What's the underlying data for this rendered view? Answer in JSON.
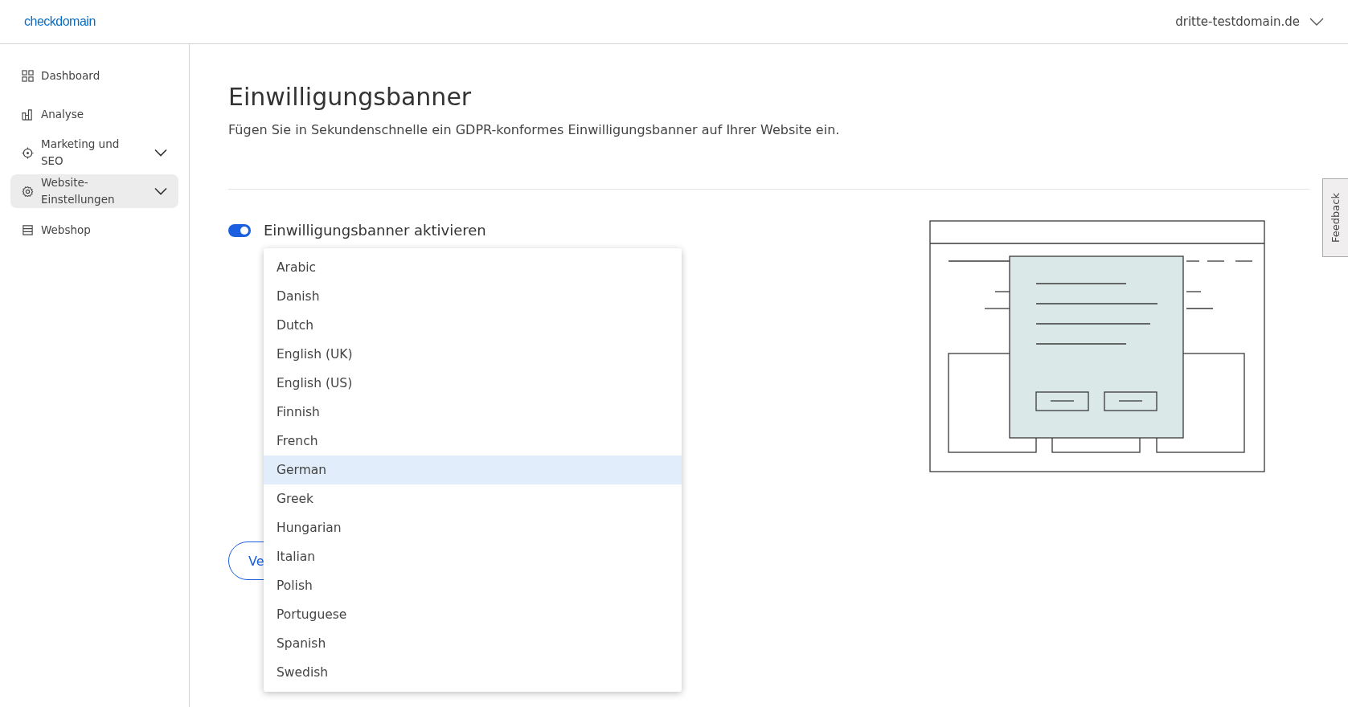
{
  "header": {
    "logo": "checkdomain",
    "domain": "dritte-testdomain.de"
  },
  "sidebar": {
    "items": [
      {
        "label": "Dashboard",
        "kind": "grid",
        "expandable": false,
        "selected": false
      },
      {
        "label": "Analyse",
        "kind": "chart",
        "expandable": false,
        "selected": false
      },
      {
        "label": "Marketing und SEO",
        "kind": "target",
        "expandable": true,
        "selected": false
      },
      {
        "label": "Website-Einstellungen",
        "kind": "gear",
        "expandable": true,
        "selected": true
      },
      {
        "label": "Webshop",
        "kind": "store",
        "expandable": false,
        "selected": false
      }
    ]
  },
  "page": {
    "title": "Einwilligungsbanner",
    "subtitle": "Fügen Sie in Sekundenschnelle ein GDPR-konformes Einwilligungsbanner auf Ihrer Website ein.",
    "toggle": {
      "label": "Einwilligungsbanner aktivieren",
      "on": true
    },
    "button": "Ve",
    "language_dropdown": {
      "options": [
        {
          "label": "Arabic",
          "selected": false
        },
        {
          "label": "Danish",
          "selected": false
        },
        {
          "label": "Dutch",
          "selected": false
        },
        {
          "label": "English (UK)",
          "selected": false
        },
        {
          "label": "English (US)",
          "selected": false
        },
        {
          "label": "Finnish",
          "selected": false
        },
        {
          "label": "French",
          "selected": false
        },
        {
          "label": "German",
          "selected": true
        },
        {
          "label": "Greek",
          "selected": false
        },
        {
          "label": "Hungarian",
          "selected": false
        },
        {
          "label": "Italian",
          "selected": false
        },
        {
          "label": "Polish",
          "selected": false
        },
        {
          "label": "Portuguese",
          "selected": false
        },
        {
          "label": "Spanish",
          "selected": false
        },
        {
          "label": "Swedish",
          "selected": false
        }
      ]
    }
  },
  "feedback_tab": "Feedback"
}
